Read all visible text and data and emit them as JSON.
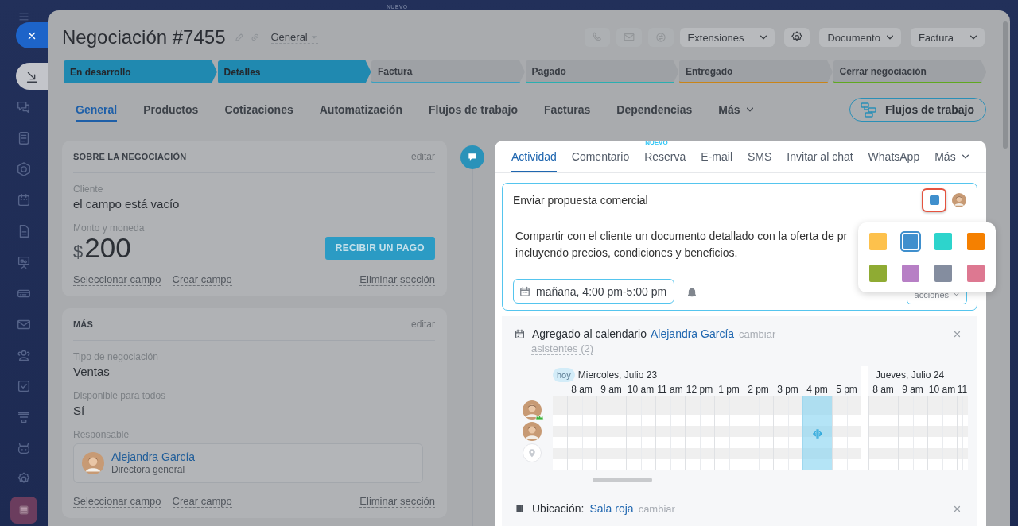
{
  "top_badge": "NUEVO",
  "sidebar": {
    "items": [
      {
        "kind": "inbox",
        "selected": true
      },
      {
        "kind": "chat",
        "selected": false
      },
      {
        "kind": "feed",
        "selected": false
      },
      {
        "kind": "hexagon",
        "selected": false
      },
      {
        "kind": "calendar",
        "selected": false
      },
      {
        "kind": "document",
        "selected": false
      },
      {
        "kind": "board",
        "selected": false
      },
      {
        "kind": "card",
        "selected": false
      },
      {
        "kind": "mail",
        "selected": false
      },
      {
        "kind": "contacts",
        "selected": false
      },
      {
        "kind": "task",
        "selected": false
      },
      {
        "kind": "funnel",
        "selected": false
      },
      {
        "kind": "robot",
        "selected": false
      },
      {
        "kind": "settings",
        "selected": false
      },
      {
        "kind": "app",
        "selected": false
      }
    ]
  },
  "header": {
    "title": "Negociación #7455",
    "category": "General",
    "actions": [
      {
        "kind": "phone"
      },
      {
        "kind": "mail"
      },
      {
        "kind": "chat"
      },
      {
        "kind": "split",
        "label": "Extensiones"
      },
      {
        "kind": "settings"
      },
      {
        "kind": "menu",
        "label": "Documento"
      },
      {
        "kind": "split",
        "label": "Factura"
      }
    ]
  },
  "stages": [
    {
      "label": "En desarrollo",
      "reached": true,
      "color": "#2089b0"
    },
    {
      "label": "Detalles",
      "reached": true,
      "color": "#2089b0"
    },
    {
      "label": "Factura",
      "reached": false,
      "color": "#3aa0c0"
    },
    {
      "label": "Pagado",
      "reached": false,
      "color": "#2aaeb0"
    },
    {
      "label": "Entregado",
      "reached": false,
      "color": "#c98418"
    },
    {
      "label": "Cerrar negociación",
      "reached": false,
      "color": "#5fa820"
    }
  ],
  "tabs": [
    {
      "label": "General",
      "selected": true,
      "menu": false
    },
    {
      "label": "Productos",
      "selected": false,
      "menu": false
    },
    {
      "label": "Cotizaciones",
      "selected": false,
      "menu": false
    },
    {
      "label": "Automatización",
      "selected": false,
      "menu": false
    },
    {
      "label": "Flujos de trabajo",
      "selected": false,
      "menu": false
    },
    {
      "label": "Facturas",
      "selected": false,
      "menu": false
    },
    {
      "label": "Dependencias",
      "selected": false,
      "menu": false
    },
    {
      "label": "Más",
      "selected": false,
      "menu": true
    }
  ],
  "workflow_button": "Flujos de trabajo",
  "sections": [
    {
      "title": "SOBRE LA NEGOCIACIÓN",
      "edit": "editar",
      "fields": [
        {
          "kind": "text",
          "label": "Cliente",
          "value": "el campo está vacío"
        },
        {
          "kind": "money",
          "label": "Monto y moneda",
          "currency": "$",
          "value": "200",
          "button": "RECIBIR UN PAGO"
        }
      ],
      "links": [
        "Seleccionar campo",
        "Crear campo"
      ],
      "delete": "Eliminar sección"
    },
    {
      "title": "MÁS",
      "edit": "editar",
      "fields": [
        {
          "kind": "text",
          "label": "Tipo de negociación",
          "value": "Ventas"
        },
        {
          "kind": "text",
          "label": "Disponible para todos",
          "value": "Sí"
        },
        {
          "kind": "person",
          "label": "Responsable",
          "value": "Alejandra García",
          "role": "Directora general"
        }
      ],
      "links": [
        "Seleccionar campo",
        "Crear campo"
      ],
      "delete": "Eliminar sección"
    }
  ],
  "activity": {
    "tabs": [
      {
        "label": "Actividad",
        "selected": true,
        "menu": false
      },
      {
        "label": "Comentario",
        "selected": false,
        "menu": false
      },
      {
        "label": "Reserva",
        "selected": false,
        "menu": false,
        "badge": "NUEVO"
      },
      {
        "label": "E-mail",
        "selected": false,
        "menu": false
      },
      {
        "label": "SMS",
        "selected": false,
        "menu": false
      },
      {
        "label": "Invitar al chat",
        "selected": false,
        "menu": false
      },
      {
        "label": "WhatsApp",
        "selected": false,
        "menu": false
      },
      {
        "label": "Más",
        "selected": false,
        "menu": true
      }
    ],
    "editor": {
      "title": "Enviar propuesta comercial",
      "description_lines": [
        "Compartir con el cliente un documento detallado con la oferta de pr",
        "incluyendo precios, condiciones y beneficios."
      ],
      "date": "mañana, 4:00 pm-5:00 pm",
      "actions": "acciones",
      "color_picker_open": true,
      "colors": [
        {
          "color": "#fdc14c",
          "selected": false
        },
        {
          "color": "#3f8fcd",
          "selected": true
        },
        {
          "color": "#2dd4cc",
          "selected": false
        },
        {
          "color": "#f58000",
          "selected": false
        },
        {
          "color": "#8fab33",
          "selected": false
        },
        {
          "color": "#b77fc5",
          "selected": false
        },
        {
          "color": "#848d9f",
          "selected": false
        },
        {
          "color": "#dd7891",
          "selected": false
        }
      ]
    },
    "calendar": {
      "title": "Agregado al calendario",
      "person": "Alejandra García",
      "change": "cambiar",
      "attendees": "asistentes (2)",
      "today": "hoy",
      "days": [
        {
          "label": "Miercoles, Julio 23",
          "today": true,
          "hours": [
            {
              "label": "8 am",
              "selected": false
            },
            {
              "label": "9 am",
              "selected": false
            },
            {
              "label": "10 am",
              "selected": false
            },
            {
              "label": "11 am",
              "selected": false
            },
            {
              "label": "12 pm",
              "selected": false
            },
            {
              "label": "1 pm",
              "selected": false
            },
            {
              "label": "2 pm",
              "selected": false
            },
            {
              "label": "3 pm",
              "selected": false
            },
            {
              "label": "4 pm",
              "selected": true
            },
            {
              "label": "5 pm",
              "selected": false
            }
          ]
        },
        {
          "label": "Jueves, Julio 24",
          "today": false,
          "hours": [
            {
              "label": "8 am",
              "selected": false
            },
            {
              "label": "9 am",
              "selected": false
            },
            {
              "label": "10 am",
              "selected": false
            },
            {
              "label": "11",
              "selected": false
            }
          ]
        }
      ],
      "rows": [
        {
          "kind": "person",
          "organizer": true
        },
        {
          "kind": "person",
          "organizer": false
        },
        {
          "kind": "location"
        }
      ]
    },
    "location": {
      "label": "Ubicación:",
      "value": "Sala roja",
      "change": "cambiar"
    }
  }
}
